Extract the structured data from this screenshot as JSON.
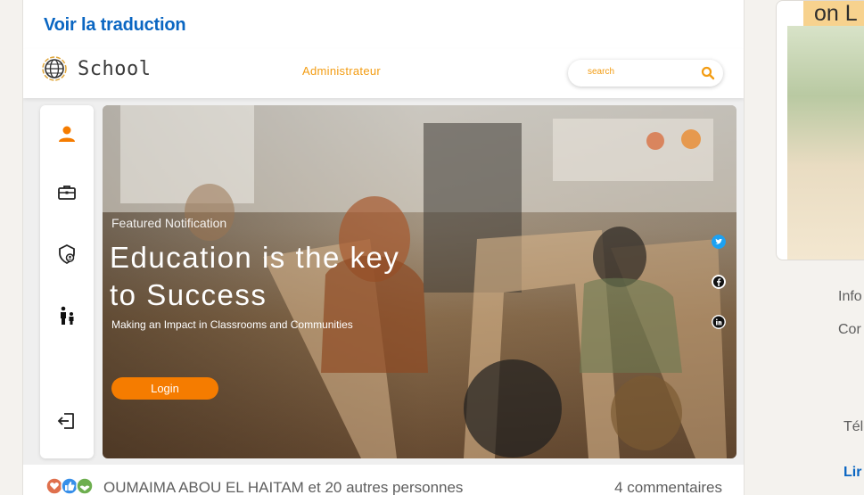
{
  "post": {
    "translation_link": "Voir la traduction",
    "reactions_text": "OUMAIMA ABOU EL HAITAM et 20 autres personnes",
    "comments_text": "4 commentaires"
  },
  "app": {
    "logo_text": "School",
    "role_label": "Administrateur",
    "search_placeholder": "search",
    "hero": {
      "kicker": "Featured Notification",
      "title_line1": "Education is the key",
      "title_line2": "to Success",
      "subtitle": "Making an Impact in Classrooms and Communities",
      "login_label": "Login"
    },
    "nav_icons": [
      "user-icon",
      "briefcase-icon",
      "shield-user-icon",
      "people-icon",
      "logout-icon"
    ],
    "social_icons": [
      "twitter-icon",
      "facebook-icon",
      "linkedin-icon"
    ]
  },
  "right_rail": {
    "ad_banner_text": "on L",
    "footer": [
      "Info",
      "Cor",
      "Télé",
      "Lir"
    ]
  },
  "colors": {
    "linkedin_blue": "#0a66c2",
    "accent_orange": "#f57c00",
    "role_orange": "#f39c12"
  }
}
